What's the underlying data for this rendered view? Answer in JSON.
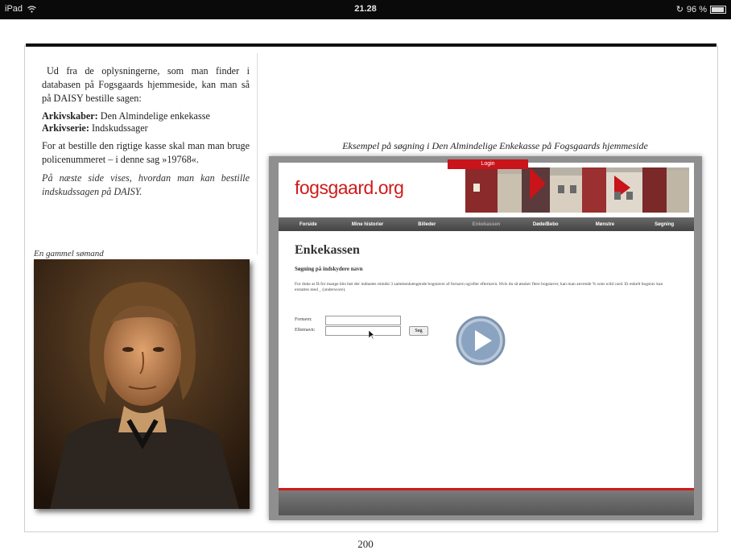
{
  "status_bar": {
    "device": "iPad",
    "time": "21.28",
    "battery": "96 %",
    "battery_level": 0.96
  },
  "left_column": {
    "intro": "Ud fra de oplysningerne, som man finder i databasen på Fogsgaards hjemmeside, kan man så på DAISY bestille sagen:",
    "arkivskaber_label": "Arkivskaber:",
    "arkivskaber_value": " Den Almindelige enkekasse",
    "arkivserie_label": "Arkivserie:",
    "arkivserie_value": " Indskudssager",
    "order_text": "For at bestille den rigtige kasse skal man man bruge policenummeret – i denne sag »19768«.",
    "next_page": "På næste side vises, hvordan man kan bestille indskudssagen på DAISY.",
    "portrait_caption": "En gammel sømand"
  },
  "site_caption": "Eksempel på søgning i Den Almindelige Enkekasse på Fogsgaards hjemmeside",
  "website": {
    "logo": "fogsgaard.org",
    "login": "Login",
    "nav": [
      "Forside",
      "Mine historier",
      "Billeder",
      "Enkekassen",
      "Døde/Bebo",
      "Mønstre",
      "Søgning"
    ],
    "page_title": "Enkekassen",
    "subtitle": "Søgning på indskydere navn",
    "description": "For doke at få for mange hits bør der indtastes mindst 3 sammenhængende bogstaver af fornavn og/eller efternavn. Hvis du så ønsker flere bogstaver, kan man anvende % som wild card. Et enkelt bogstav kan erstattes med _ (underscore).",
    "fornavn_label": "Fornavn:",
    "efternavn_label": "Efternavn:",
    "search_button": "Søg"
  },
  "page_number": "200",
  "colors": {
    "accent_red": "#d01a1a",
    "status_bar": "#0a0a0a",
    "nav_gray": "#555555"
  }
}
